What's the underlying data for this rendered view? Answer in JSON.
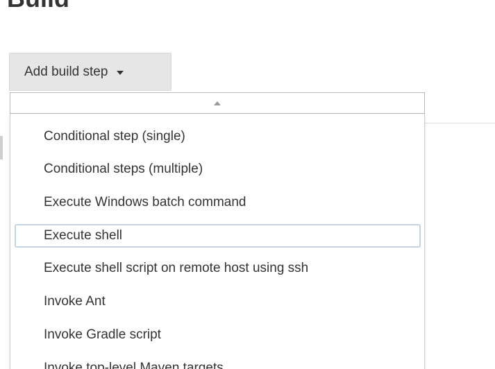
{
  "section": {
    "title": "Build"
  },
  "add_button": {
    "label": "Add build step"
  },
  "menu": {
    "items": [
      {
        "label": "Conditional step (single)"
      },
      {
        "label": "Conditional steps (multiple)"
      },
      {
        "label": "Execute Windows batch command"
      },
      {
        "label": "Execute shell",
        "selected": true
      },
      {
        "label": "Execute shell script on remote host using ssh"
      },
      {
        "label": "Invoke Ant"
      },
      {
        "label": "Invoke Gradle script"
      },
      {
        "label": "Invoke top-level Maven targets"
      }
    ]
  },
  "colors": {
    "button_bg": "#e6e6e6",
    "text": "#333333",
    "selected_border": "#c3d3e6"
  }
}
